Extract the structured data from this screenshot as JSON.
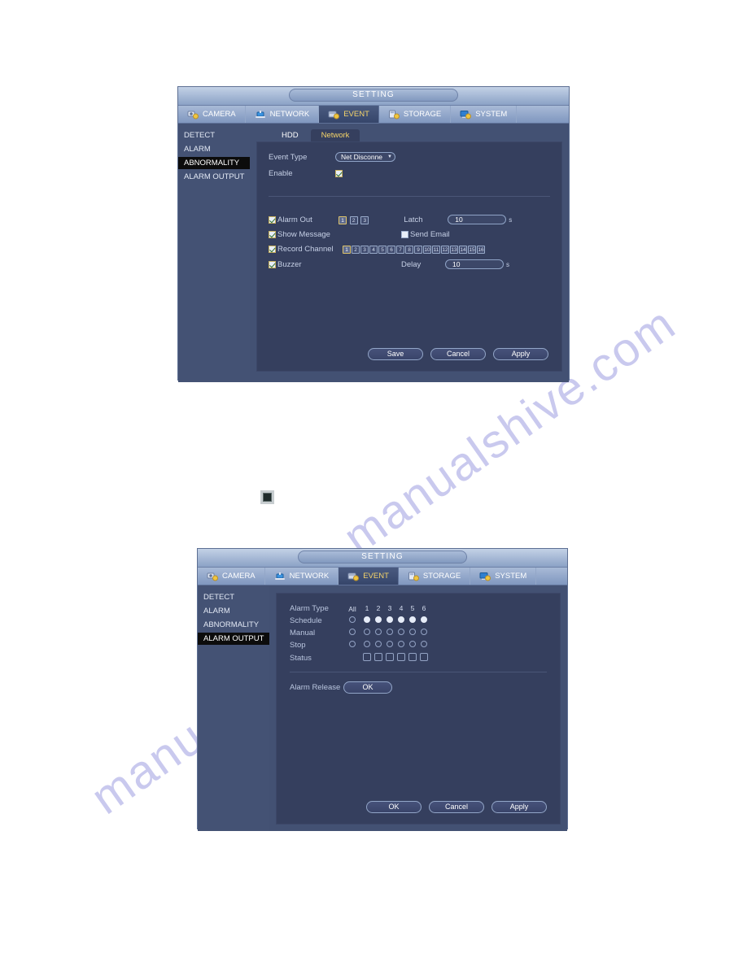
{
  "page": {
    "watermark_text": "manualshive.com"
  },
  "figure1": {
    "title": "SETTING",
    "tabs": [
      {
        "label": "CAMERA",
        "icon": "camera-icon",
        "active": false
      },
      {
        "label": "NETWORK",
        "icon": "network-icon",
        "active": false
      },
      {
        "label": "EVENT",
        "icon": "event-icon",
        "active": true
      },
      {
        "label": "STORAGE",
        "icon": "storage-icon",
        "active": false
      },
      {
        "label": "SYSTEM",
        "icon": "system-icon",
        "active": false
      }
    ],
    "sidebar": [
      {
        "label": "DETECT",
        "active": false
      },
      {
        "label": "ALARM",
        "active": false
      },
      {
        "label": "ABNORMALITY",
        "active": true
      },
      {
        "label": "ALARM OUTPUT",
        "active": false
      }
    ],
    "inner_tabs": [
      {
        "label": "HDD",
        "active": false
      },
      {
        "label": "Network",
        "active": true
      }
    ],
    "form": {
      "event_type_label": "Event Type",
      "event_type_value": "Net Disconne",
      "enable_label": "Enable",
      "enable_checked": true,
      "alarm_out_label": "Alarm Out",
      "alarm_out_checked": true,
      "alarm_out_channels": [
        "1",
        "2",
        "3"
      ],
      "alarm_out_selected": [
        "1"
      ],
      "latch_label": "Latch",
      "latch_value": "10",
      "latch_unit": "s",
      "show_message_label": "Show Message",
      "show_message_checked": true,
      "send_email_label": "Send Email",
      "send_email_checked": false,
      "record_channel_label": "Record Channel",
      "record_channel_checked": true,
      "record_channels": [
        "1",
        "2",
        "3",
        "4",
        "5",
        "6",
        "7",
        "8",
        "9",
        "10",
        "11",
        "12",
        "13",
        "14",
        "15",
        "16"
      ],
      "record_channels_selected": [
        "1"
      ],
      "buzzer_label": "Buzzer",
      "buzzer_checked": true,
      "delay_label": "Delay",
      "delay_value": "10",
      "delay_unit": "s"
    },
    "buttons": [
      {
        "label": "Save"
      },
      {
        "label": "Cancel"
      },
      {
        "label": "Apply"
      }
    ]
  },
  "figure2": {
    "title": "SETTING",
    "tabs": [
      {
        "label": "CAMERA",
        "icon": "camera-icon",
        "active": false
      },
      {
        "label": "NETWORK",
        "icon": "network-icon",
        "active": false
      },
      {
        "label": "EVENT",
        "icon": "event-icon",
        "active": true
      },
      {
        "label": "STORAGE",
        "icon": "storage-icon",
        "active": false
      },
      {
        "label": "SYSTEM",
        "icon": "system-icon",
        "active": false
      }
    ],
    "sidebar": [
      {
        "label": "DETECT",
        "active": false
      },
      {
        "label": "ALARM",
        "active": false
      },
      {
        "label": "ABNORMALITY",
        "active": false
      },
      {
        "label": "ALARM OUTPUT",
        "active": true
      }
    ],
    "matrix": {
      "row_label_alarm_type": "Alarm Type",
      "col_all": "All",
      "columns": [
        "1",
        "2",
        "3",
        "4",
        "5",
        "6"
      ],
      "rows": [
        {
          "label": "Schedule",
          "all": false,
          "values": [
            true,
            true,
            true,
            true,
            true,
            true
          ],
          "kind": "radio"
        },
        {
          "label": "Manual",
          "all": false,
          "values": [
            false,
            false,
            false,
            false,
            false,
            false
          ],
          "kind": "radio"
        },
        {
          "label": "Stop",
          "all": false,
          "values": [
            false,
            false,
            false,
            false,
            false,
            false
          ],
          "kind": "radio"
        },
        {
          "label": "Status",
          "all": null,
          "values": [
            false,
            false,
            false,
            false,
            false,
            false
          ],
          "kind": "square"
        }
      ]
    },
    "alarm_release_label": "Alarm Release",
    "alarm_release_button": "OK",
    "buttons": [
      {
        "label": "OK"
      },
      {
        "label": "Cancel"
      },
      {
        "label": "Apply"
      }
    ]
  }
}
